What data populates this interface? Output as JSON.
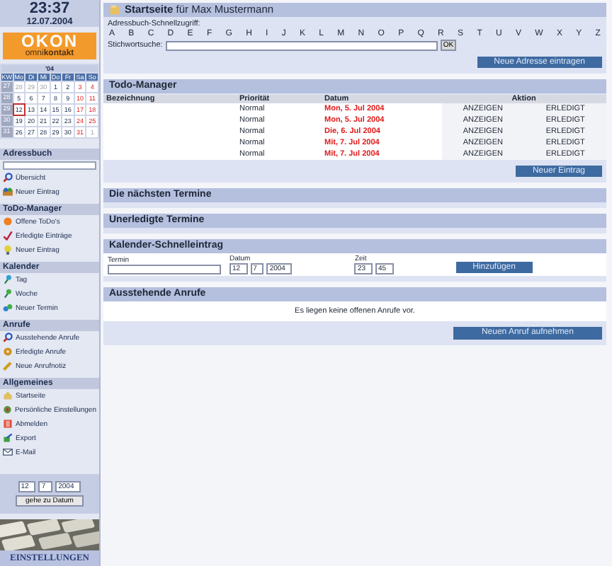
{
  "clock": {
    "time": "23:37",
    "date": "12.07.2004"
  },
  "logo": {
    "name": "OKON",
    "tagline": "omni**kontakt**"
  },
  "calendar": {
    "title": "'04",
    "headers": [
      "KW",
      "Mo",
      "Di",
      "Mi",
      "Do",
      "Fr",
      "Sa",
      "So"
    ],
    "weeks": [
      {
        "week": "27",
        "days": [
          {
            "day": "28",
            "kind": "other"
          },
          {
            "day": "29",
            "kind": "other"
          },
          {
            "day": "30",
            "kind": "other"
          },
          {
            "day": "1",
            "kind": "normal"
          },
          {
            "day": "2",
            "kind": "normal"
          },
          {
            "day": "3",
            "kind": "weekend"
          },
          {
            "day": "4",
            "kind": "weekend"
          }
        ]
      },
      {
        "week": "28",
        "days": [
          {
            "day": "5",
            "kind": "normal"
          },
          {
            "day": "6",
            "kind": "normal"
          },
          {
            "day": "7",
            "kind": "normal"
          },
          {
            "day": "8",
            "kind": "normal"
          },
          {
            "day": "9",
            "kind": "normal"
          },
          {
            "day": "10",
            "kind": "weekend"
          },
          {
            "day": "11",
            "kind": "weekend"
          }
        ]
      },
      {
        "week": "29",
        "days": [
          {
            "day": "12",
            "kind": "today"
          },
          {
            "day": "13",
            "kind": "normal"
          },
          {
            "day": "14",
            "kind": "normal"
          },
          {
            "day": "15",
            "kind": "normal"
          },
          {
            "day": "16",
            "kind": "normal"
          },
          {
            "day": "17",
            "kind": "weekend"
          },
          {
            "day": "18",
            "kind": "weekend"
          }
        ]
      },
      {
        "week": "30",
        "days": [
          {
            "day": "19",
            "kind": "normal"
          },
          {
            "day": "20",
            "kind": "normal"
          },
          {
            "day": "21",
            "kind": "normal"
          },
          {
            "day": "22",
            "kind": "normal"
          },
          {
            "day": "23",
            "kind": "normal"
          },
          {
            "day": "24",
            "kind": "weekend"
          },
          {
            "day": "25",
            "kind": "weekend"
          }
        ]
      },
      {
        "week": "31",
        "days": [
          {
            "day": "26",
            "kind": "normal"
          },
          {
            "day": "27",
            "kind": "normal"
          },
          {
            "day": "28",
            "kind": "normal"
          },
          {
            "day": "29",
            "kind": "normal"
          },
          {
            "day": "30",
            "kind": "normal"
          },
          {
            "day": "31",
            "kind": "weekend"
          },
          {
            "day": "1",
            "kind": "other"
          }
        ]
      }
    ]
  },
  "sidebar": {
    "sections": [
      {
        "title": "Adressbuch",
        "kind": "search",
        "items": [
          "Übersicht",
          "Neuer Eintrag"
        ]
      },
      {
        "title": "ToDo-Manager",
        "kind": "plain",
        "items": [
          "Offene ToDo's",
          "Erledigte Einträge",
          "Neuer Eintrag"
        ]
      },
      {
        "title": "Kalender",
        "kind": "plain",
        "items": [
          "Tag",
          "Woche",
          "Neuer Termin"
        ]
      },
      {
        "title": "Anrufe",
        "kind": "plain",
        "items": [
          "Ausstehende Anrufe",
          "Erledigte Anrufe",
          "Neue Anrufnotiz"
        ]
      },
      {
        "title": "Allgemeines",
        "kind": "plain",
        "items": [
          "Startseite",
          "Persönliche Einstellungen",
          "Abmelden",
          "Export",
          "E-Mail"
        ]
      }
    ]
  },
  "date_picker": {
    "day": "12",
    "month": "7",
    "year": "2004",
    "button": "gehe zu Datum"
  },
  "banner": {
    "kind": "picture",
    "label": "EINSTELLUNGEN"
  },
  "title": "**Startseite** für Max Mustermann",
  "quick_access": {
    "label": "Adressbuch-Schnellzugriff:",
    "letters": [
      "A",
      "B",
      "C",
      "D",
      "E",
      "F",
      "G",
      "H",
      "I",
      "J",
      "K",
      "L",
      "M",
      "N",
      "O",
      "P",
      "Q",
      "R",
      "S",
      "T",
      "U",
      "V",
      "W",
      "X",
      "Y",
      "Z"
    ],
    "search_label": "Stichwortsuche:",
    "search_button": "OK",
    "add_button": "Neue Adresse eintragen"
  },
  "todo": {
    "title": "Todo-Manager",
    "columns": [
      "Bezeichnung",
      "Priorität",
      "Datum",
      "Aktion"
    ],
    "rows": [
      {
        "priority": "Normal",
        "date": "Mon, 5. Jul 2004",
        "overdue": true,
        "actions": [
          "ANZEIGEN",
          "ERLEDIGT"
        ]
      },
      {
        "priority": "Normal",
        "date": "Mon, 5. Jul 2004",
        "overdue": true,
        "actions": [
          "ANZEIGEN",
          "ERLEDIGT"
        ]
      },
      {
        "priority": "Normal",
        "date": "Die, 6. Jul 2004",
        "overdue": true,
        "actions": [
          "ANZEIGEN",
          "ERLEDIGT"
        ]
      },
      {
        "priority": "Normal",
        "date": "Mit, 7. Jul 2004",
        "overdue": true,
        "actions": [
          "ANZEIGEN",
          "ERLEDIGT"
        ]
      },
      {
        "priority": "Normal",
        "date": "Mit, 7. Jul 2004",
        "overdue": true,
        "actions": [
          "ANZEIGEN",
          "ERLEDIGT"
        ]
      }
    ],
    "button": "Neuer Eintrag"
  },
  "empty_panels": [
    "Die nächsten Termine",
    "Unerledigte Termine"
  ],
  "quick_entry": {
    "title": "Kalender-Schnelleintrag",
    "term_label": "Termin",
    "date_label": "Datum",
    "day": "12",
    "month": "7",
    "year": "2004",
    "time_label": "Zeit",
    "hour": "23",
    "minute": "45",
    "button": "Hinzufügen"
  },
  "calls": {
    "title": "Ausstehende Anrufe",
    "message": "Es liegen keine offenen Anrufe vor.",
    "button": "Neuen Anruf aufnehmen"
  }
}
